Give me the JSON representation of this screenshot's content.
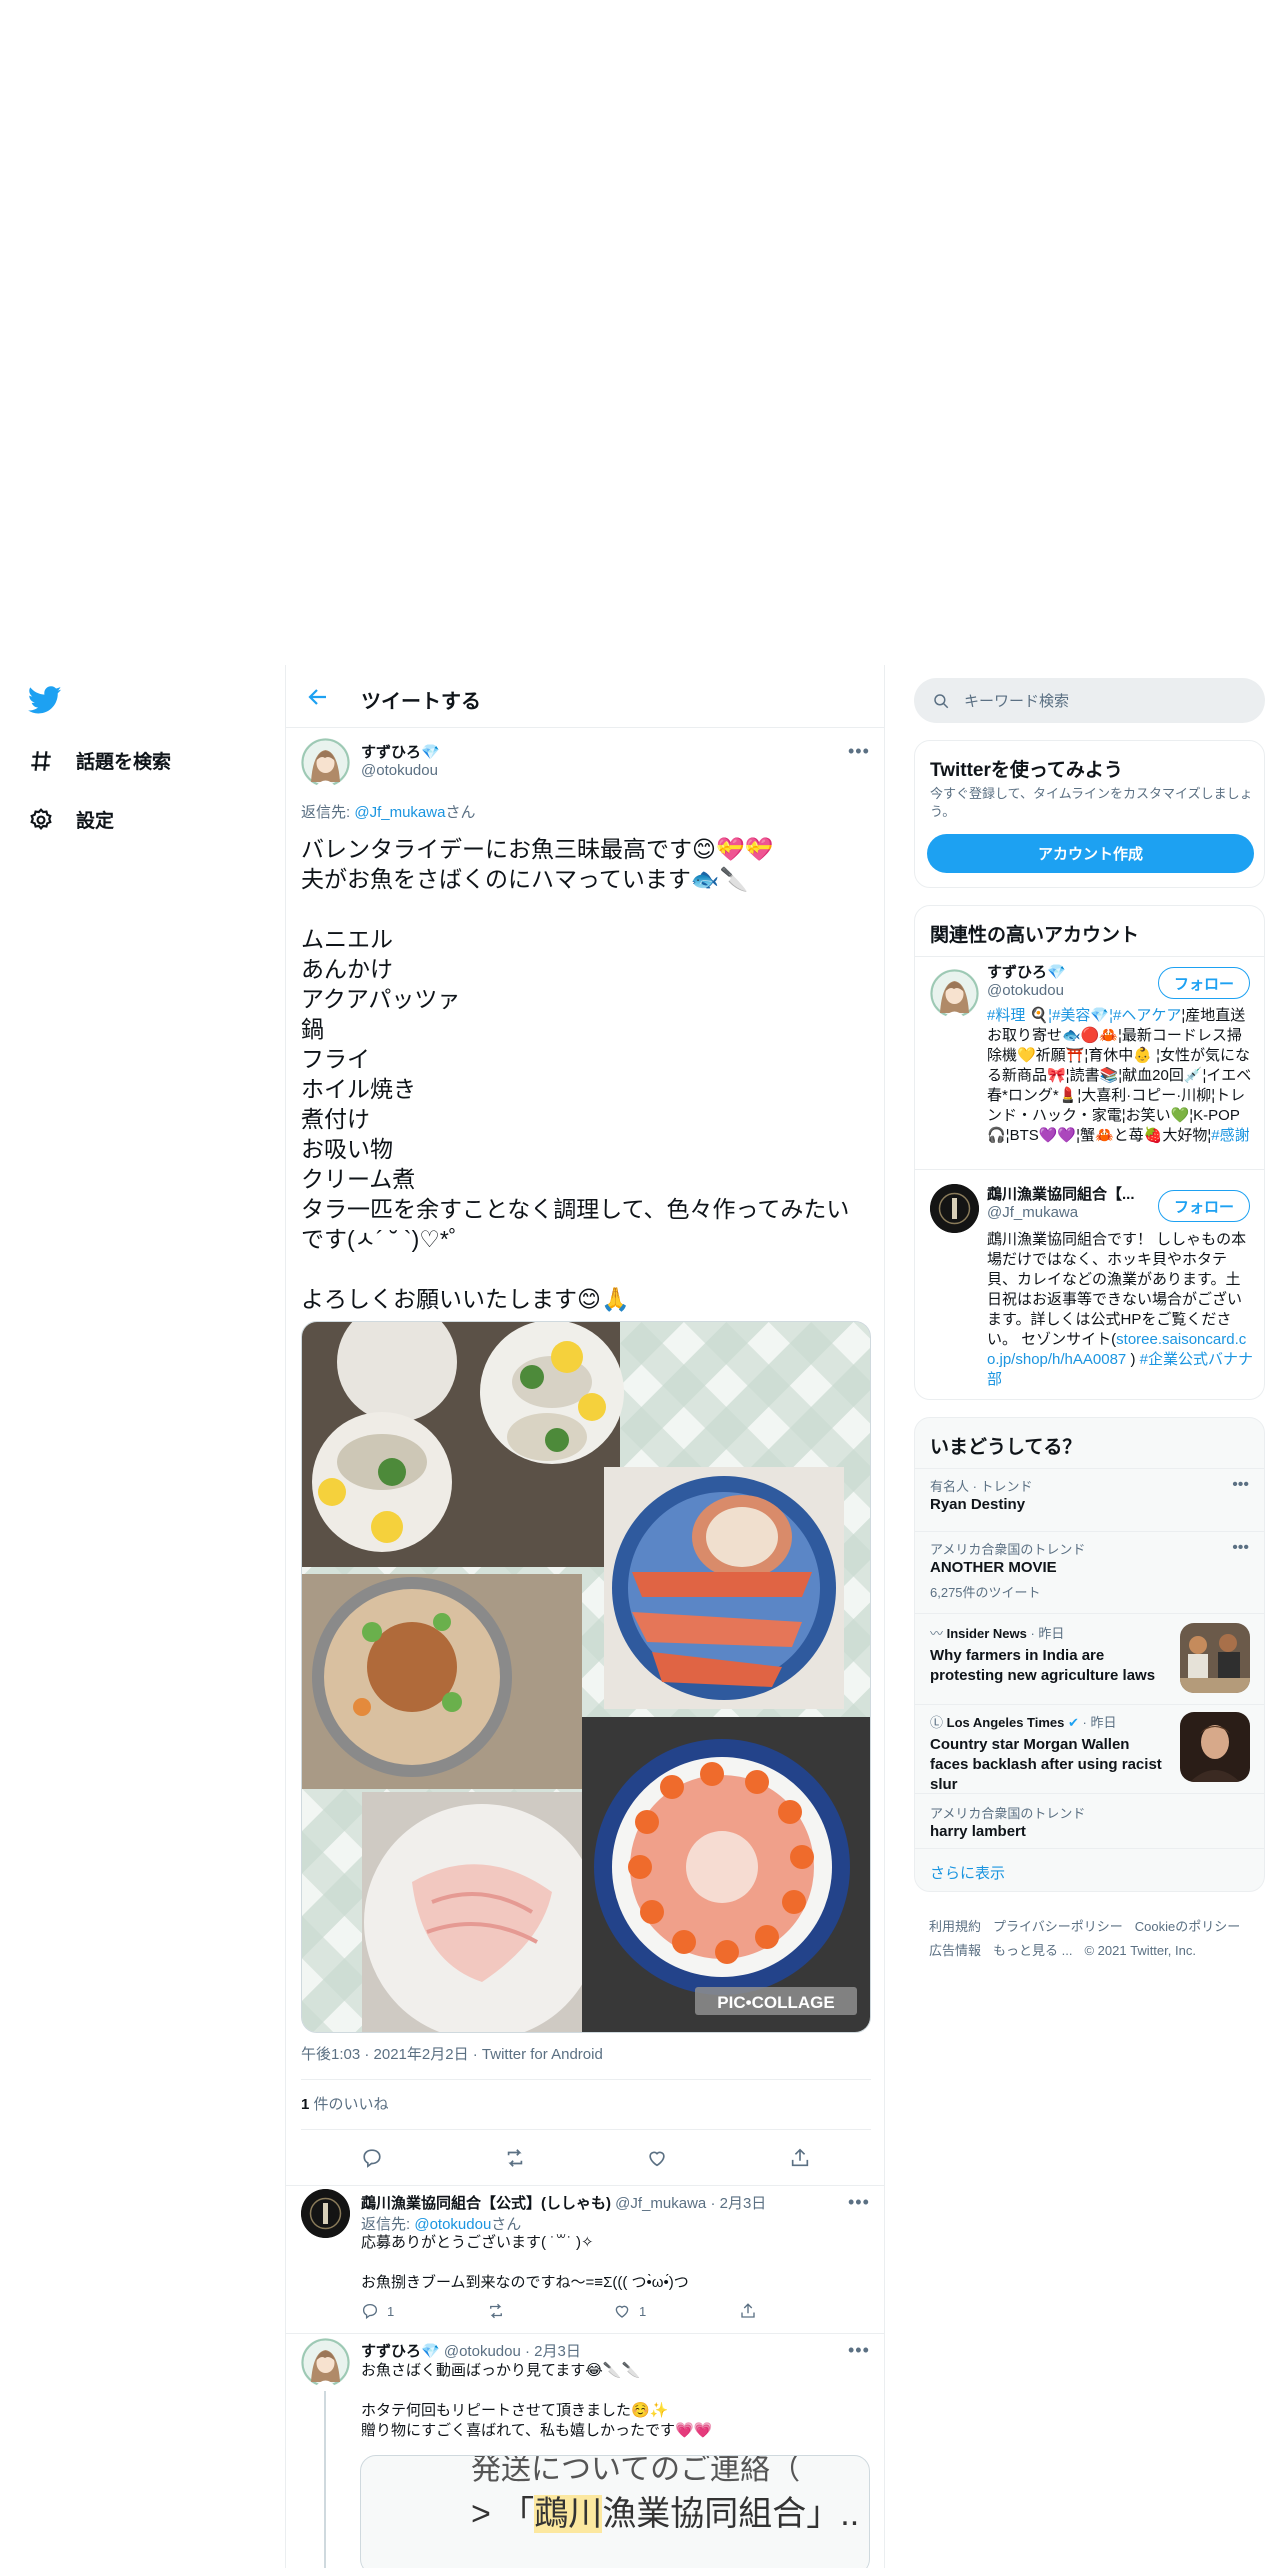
{
  "nav": {
    "items": [
      {
        "label": "話題を検索",
        "icon": "hashtag-icon"
      },
      {
        "label": "設定",
        "icon": "gear-icon"
      }
    ]
  },
  "header": {
    "title": "ツイートする"
  },
  "tweet": {
    "author_name": "すずひろ💎",
    "author_handle": "@otokudou",
    "reply_prefix": "返信先: ",
    "reply_to": "@Jf_mukawa",
    "reply_suffix": "さん",
    "text": "バレンタライデーにお魚三昧最高です😊💝💝\n夫がお魚をさばくのにハマっています🐟🔪\n\nムニエル\nあんかけ\nアクアパッツァ\n鍋\nフライ\nホイル焼き\n煮付け\nお吸い物\nクリーム煮\nタラ一匹を余すことなく調理して、色々作ってみたいです(ㅅ´ ˘ `)♡*゜\n\nよろしくお願いいたします😊🙏",
    "watermark": "PIC•COLLAGE",
    "meta": "午後1:03 · 2021年2月2日 · Twitter for Android",
    "likes_count": "1",
    "likes_label": " 件のいいね"
  },
  "replies": [
    {
      "name": "鵡川漁業協同組合【公式】(ししゃも)",
      "handle": "@Jf_mukawa",
      "date": "· 2月3日",
      "reply_prefix": "返信先: ",
      "reply_to": "@otokudou",
      "reply_suffix": "さん",
      "text": "応募ありがとうございます( ˙꒳˙ )✧\n\nお魚捌きブーム到来なのですね〜=≡Σ((( つ•̀ω•́)つ",
      "reply_count": "1",
      "like_count": "1"
    },
    {
      "name": "すずひろ💎",
      "handle": "@otokudou",
      "date": "· 2月3日",
      "text": "お魚さばく動画ばっかり見てます😂🔪🔪\n\nホタテ何回もリピートさせて頂きました☺️✨\n贈り物にすごく喜ばれて、私も嬉しかったです💗💗",
      "embed_line1": "発送についてのご連絡（",
      "embed_line2_pre": "> 「",
      "embed_line2_hl": "鵡川",
      "embed_line2_post": "漁業協同組合」.."
    }
  ],
  "sidebar": {
    "search_placeholder": "キーワード検索",
    "signup": {
      "title": "Twitterを使ってみよう",
      "desc": "今すぐ登録して、タイムラインをカスタマイズしましょう。",
      "button": "アカウント作成"
    },
    "related": {
      "title": "関連性の高いアカウント",
      "follow_label": "フォロー",
      "accounts": [
        {
          "name": "すずひろ💎",
          "handle": "@otokudou",
          "bio_tags": "#料理 🍳¦#美容💎¦#ヘアケア",
          "bio": "¦産地直送お取り寄せ🐟🔴🦀¦最新コードレス掃除機💛祈願⛩️¦育休中👶 ¦女性が気になる新商品🎀¦読書📚¦献血20回💉¦イエベ春*ロング*💄¦大喜利·コピー·川柳¦トレンド・ハック・家電¦お笑い💚¦K-POP🎧¦BTS💜💜¦蟹🦀と苺🍓大好物¦",
          "bio_end": "#感謝"
        },
        {
          "name": "鵡川漁業協同組合【...",
          "handle": "@Jf_mukawa",
          "bio": "鵡川漁業協同組合です！ ししゃもの本場だけではなく、ホッキ貝やホタテ貝、カレイなどの漁業があります。土日祝はお返事等できない場合がございます。詳しくは公式HPをご覧ください。 セゾンサイト(",
          "bio_link": "storee.saisoncard.co.jp/shop/h/hAA0087",
          "bio_tail": " ) ",
          "bio_tag": "#企業公式バナナ部"
        }
      ]
    },
    "trends": {
      "title": "いまどうしてる？",
      "items": [
        {
          "category": "有名人 · トレンド",
          "title": "Ryan Destiny"
        },
        {
          "category": "アメリカ合衆国のトレンド",
          "title": "ANOTHER MOVIE",
          "count": "6,275件のツイート"
        },
        {
          "source": "Insider News",
          "time": "· 昨日",
          "title": "Why farmers in India are protesting new agriculture laws"
        },
        {
          "source": "Los Angeles Times",
          "time": "· 昨日",
          "title": "Country star Morgan Wallen faces backlash after using racist slur"
        },
        {
          "category": "アメリカ合衆国のトレンド",
          "title": "harry lambert"
        }
      ],
      "show_more": "さらに表示"
    },
    "footer": {
      "links": [
        "利用規約",
        "プライバシーポリシー",
        "Cookieのポリシー",
        "広告情報",
        "もっと見る ...",
        "© 2021 Twitter, Inc."
      ]
    }
  },
  "colors": {
    "accent": "#1da1f2",
    "link": "#1b95e0",
    "muted": "#5b7083",
    "border": "#ebeef0"
  }
}
